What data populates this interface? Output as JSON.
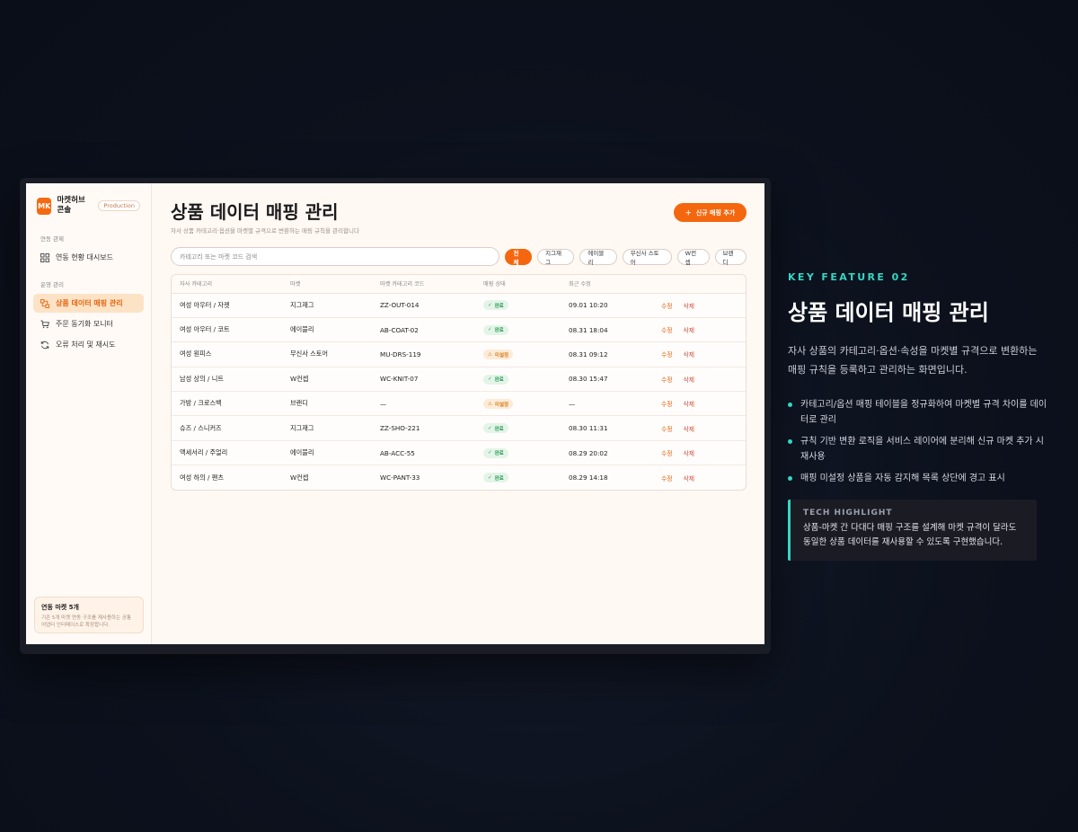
{
  "app": {
    "logo_text": "MK",
    "name": "마켓허브 콘솔",
    "env_badge": "Production"
  },
  "sidebar": {
    "section1": "연동 관제",
    "section2": "운영 관리",
    "items": [
      {
        "label": "연동 현황 대시보드",
        "icon": "dashboard-icon"
      },
      {
        "label": "상품 데이터 매핑 관리",
        "icon": "mapping-icon",
        "active": true
      },
      {
        "label": "주문 동기화 모니터",
        "icon": "cart-icon"
      },
      {
        "label": "오류 처리 및 재시도",
        "icon": "retry-icon"
      }
    ],
    "card": {
      "title": "연동 마켓 5개",
      "desc": "기존 5개 마켓 연동 구조를 재사용하는 공통 어댑터 인터페이스로 확장합니다."
    }
  },
  "main": {
    "title": "상품 데이터 매핑 관리",
    "subtitle": "자사 상품 카테고리·옵션을 마켓별 규격으로 변환하는 매핑 규칙을 관리합니다",
    "add_button": "신규 매핑 추가",
    "search_placeholder": "카테고리 또는 마켓 코드 검색",
    "filters": [
      "전체",
      "지그재그",
      "에이블리",
      "무신사 스토어",
      "W컨셉",
      "브랜디"
    ],
    "active_filter": "전체",
    "columns": [
      "자사 카테고리",
      "마켓",
      "마켓 카테고리 코드",
      "매핑 상태",
      "최근 수정",
      ""
    ],
    "edit_label": "수정",
    "delete_label": "삭제",
    "rows": [
      {
        "category": "여성 아우터 / 자켓",
        "market": "지그재그",
        "code": "ZZ-OUT-014",
        "status": "완료",
        "status_type": "done",
        "updated": "09.01 10:20"
      },
      {
        "category": "여성 아우터 / 코트",
        "market": "에이블리",
        "code": "AB-COAT-02",
        "status": "완료",
        "status_type": "done",
        "updated": "08.31 18:04"
      },
      {
        "category": "여성 원피스",
        "market": "무신사 스토어",
        "code": "MU-DRS-119",
        "status": "미설정",
        "status_type": "unset",
        "updated": "08.31 09:12"
      },
      {
        "category": "남성 상의 / 니트",
        "market": "W컨셉",
        "code": "WC-KNIT-07",
        "status": "완료",
        "status_type": "done",
        "updated": "08.30 15:47"
      },
      {
        "category": "가방 / 크로스백",
        "market": "브랜디",
        "code": "—",
        "status": "미설정",
        "status_type": "unset",
        "updated": "—"
      },
      {
        "category": "슈즈 / 스니커즈",
        "market": "지그재그",
        "code": "ZZ-SHO-221",
        "status": "완료",
        "status_type": "done",
        "updated": "08.30 11:31"
      },
      {
        "category": "액세서리 / 주얼리",
        "market": "에이블리",
        "code": "AB-ACC-55",
        "status": "완료",
        "status_type": "done",
        "updated": "08.29 20:02"
      },
      {
        "category": "여성 하의 / 팬츠",
        "market": "W컨셉",
        "code": "WC-PANT-33",
        "status": "완료",
        "status_type": "done",
        "updated": "08.29 14:18"
      }
    ]
  },
  "copy": {
    "kicker": "KEY FEATURE 02",
    "headline": "상품 데이터 매핑 관리",
    "description": "자사 상품의 카테고리·옵션·속성을 마켓별 규격으로 변환하는 매핑 규칙을 등록하고 관리하는 화면입니다.",
    "bullets": [
      "카테고리/옵션 매핑 테이블을 정규화하여 마켓별 규격 차이를 데이터로 관리",
      "규칙 기반 변환 로직을 서비스 레이어에 분리해 신규 마켓 추가 시 재사용",
      "매핑 미설정 상품을 자동 감지해 목록 상단에 경고 표시"
    ],
    "highlight_title": "TECH HIGHLIGHT",
    "highlight_body": "상품-마켓 간 다대다 매핑 구조를 설계해 마켓 규격이 달라도 동일한 상품 데이터를 재사용할 수 있도록 구현했습니다."
  },
  "colors": {
    "accent": "#f4670f",
    "teal": "#35d6c3",
    "done": "#2f9a55",
    "unset": "#d57f1d"
  }
}
